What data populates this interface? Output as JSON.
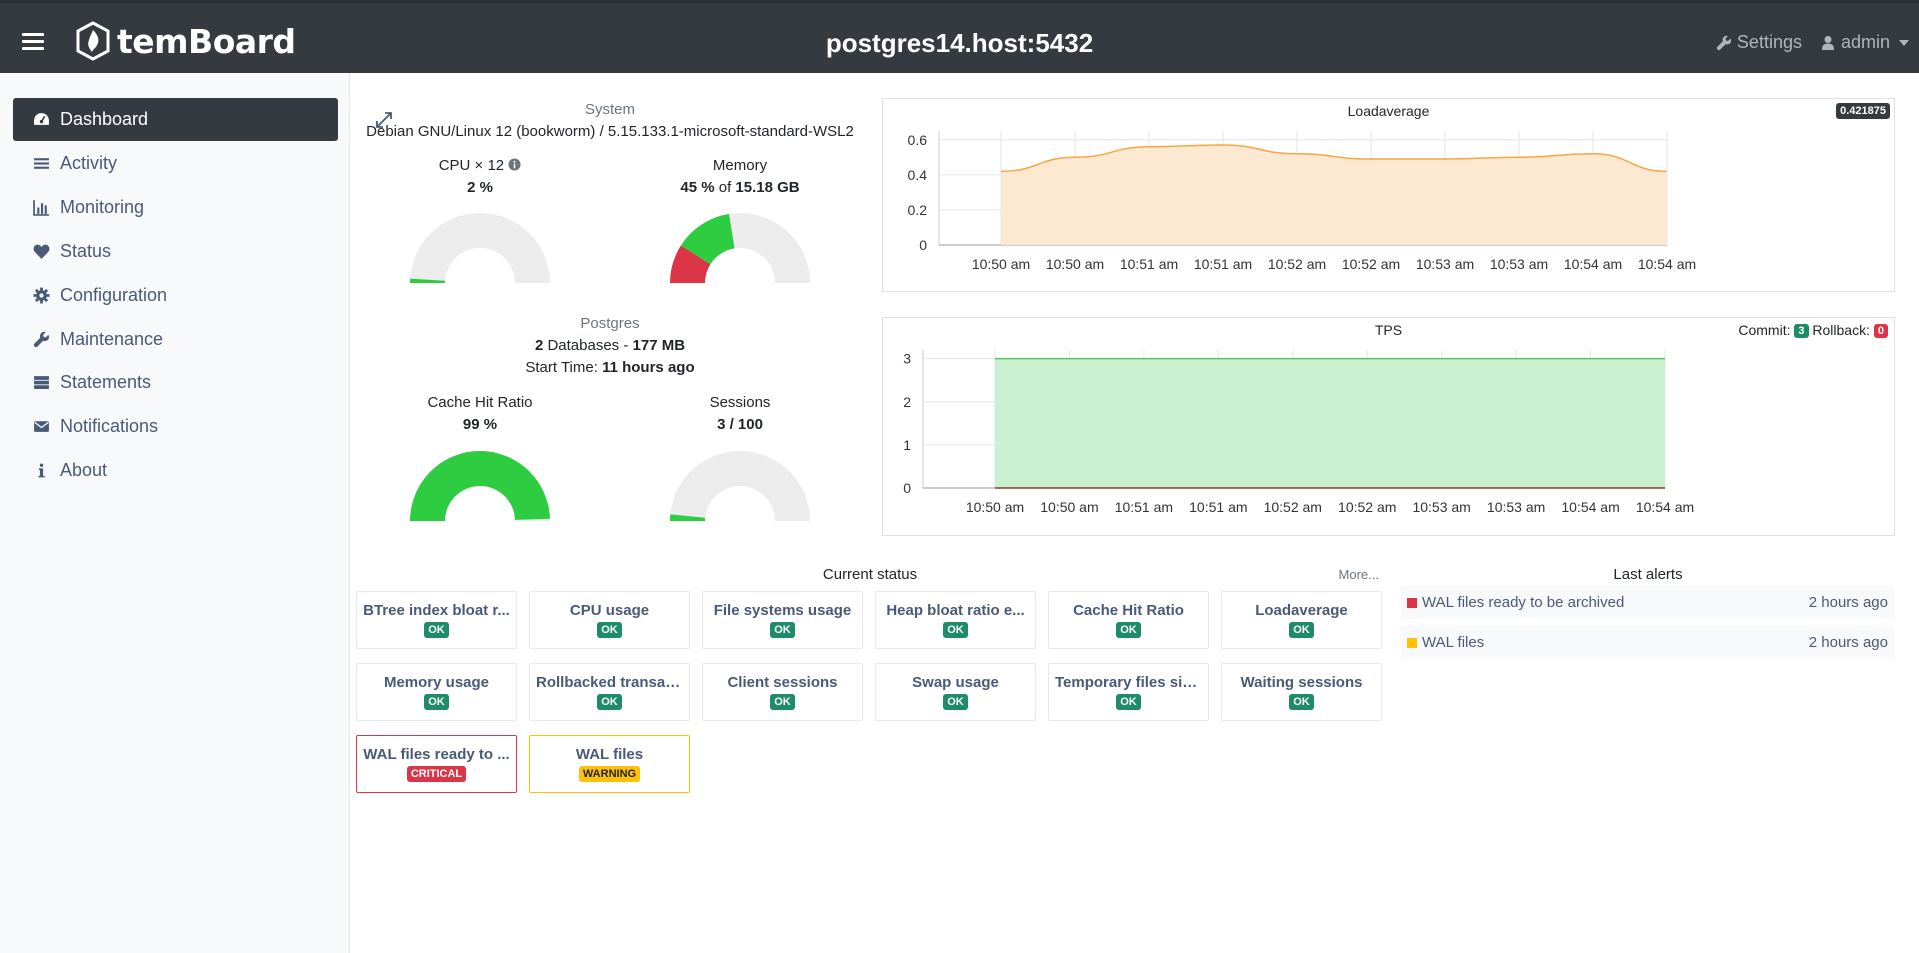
{
  "app": {
    "brand": "temBoard",
    "instance": "postgres14.host:5432"
  },
  "topnav": {
    "settings": "Settings",
    "user": "admin"
  },
  "sidebar": {
    "items": [
      {
        "label": "Dashboard",
        "icon": "dashboard-icon",
        "active": true
      },
      {
        "label": "Activity",
        "icon": "bars-icon"
      },
      {
        "label": "Monitoring",
        "icon": "bar-chart-icon"
      },
      {
        "label": "Status",
        "icon": "heart-icon"
      },
      {
        "label": "Configuration",
        "icon": "gear-icon"
      },
      {
        "label": "Maintenance",
        "icon": "wrench-icon"
      },
      {
        "label": "Statements",
        "icon": "server-icon"
      },
      {
        "label": "Notifications",
        "icon": "envelope-icon"
      },
      {
        "label": "About",
        "icon": "info-icon"
      }
    ]
  },
  "system": {
    "heading": "System",
    "os": "Debian GNU/Linux 12 (bookworm) / 5.15.133.1-microsoft-standard-WSL2",
    "cpu_label": "CPU × 12",
    "cpu_value": "2 %",
    "cpu_fraction": 0.02,
    "memory_label": "Memory",
    "memory_pct": "45 %",
    "memory_of": "of",
    "memory_total": "15.18 GB",
    "memory_fraction_used": 0.45
  },
  "postgres": {
    "heading": "Postgres",
    "db_count": "2",
    "db_text": "Databases -",
    "db_size": "177 MB",
    "start_label": "Start Time:",
    "start_value": "11 hours ago",
    "cache_label": "Cache Hit Ratio",
    "cache_value": "99 %",
    "cache_fraction": 0.99,
    "sessions_label": "Sessions",
    "sessions_value": "3 / 100",
    "sessions_fraction": 0.03
  },
  "loadavg": {
    "title": "Loadaverage",
    "current": "0.421875"
  },
  "tps": {
    "title": "TPS",
    "commit_label": "Commit:",
    "commit_value": "3",
    "rollback_label": "Rollback:",
    "rollback_value": "0"
  },
  "status": {
    "heading": "Current status",
    "more": "More...",
    "items": [
      {
        "name": "BTree index bloat r...",
        "state": "OK"
      },
      {
        "name": "CPU usage",
        "state": "OK"
      },
      {
        "name": "File systems usage",
        "state": "OK"
      },
      {
        "name": "Heap bloat ratio e...",
        "state": "OK"
      },
      {
        "name": "Cache Hit Ratio",
        "state": "OK"
      },
      {
        "name": "Loadaverage",
        "state": "OK"
      },
      {
        "name": "Memory usage",
        "state": "OK"
      },
      {
        "name": "Rollbacked transac...",
        "state": "OK"
      },
      {
        "name": "Client sessions",
        "state": "OK"
      },
      {
        "name": "Swap usage",
        "state": "OK"
      },
      {
        "name": "Temporary files siz...",
        "state": "OK"
      },
      {
        "name": "Waiting sessions",
        "state": "OK"
      },
      {
        "name": "WAL files ready to ...",
        "state": "CRITICAL"
      },
      {
        "name": "WAL files",
        "state": "WARNING"
      }
    ]
  },
  "alerts": {
    "heading": "Last alerts",
    "items": [
      {
        "text": "WAL files ready to be archived",
        "when": "2 hours ago",
        "color": "#dc3545"
      },
      {
        "text": "WAL files",
        "when": "2 hours ago",
        "color": "#ffc107"
      }
    ]
  },
  "colors": {
    "ok": "#1e8c67",
    "critical": "#dc3545",
    "warning": "#ffc107",
    "gauge_green": "#2ecc40",
    "load_line": "#f5a742",
    "load_fill": "#fde8d2",
    "tps_fill": "#c9f0cf",
    "tps_line": "#5ac464"
  },
  "chart_data": [
    {
      "type": "area",
      "title": "Loadaverage",
      "x": [
        "10:50 am",
        "10:50 am",
        "10:51 am",
        "10:51 am",
        "10:52 am",
        "10:52 am",
        "10:53 am",
        "10:53 am",
        "10:54 am",
        "10:54 am"
      ],
      "series": [
        {
          "values": [
            0.42,
            0.5,
            0.56,
            0.57,
            0.52,
            0.49,
            0.49,
            0.5,
            0.52,
            0.42
          ]
        }
      ],
      "yticks": [
        "0",
        "0.2",
        "0.4",
        "0.6"
      ],
      "ylim": [
        0,
        0.65
      ],
      "grid": true
    },
    {
      "type": "area",
      "title": "TPS",
      "x": [
        "10:50 am",
        "10:50 am",
        "10:51 am",
        "10:51 am",
        "10:52 am",
        "10:52 am",
        "10:53 am",
        "10:53 am",
        "10:54 am",
        "10:54 am"
      ],
      "series": [
        {
          "name": "Commit",
          "values": [
            3,
            3,
            3,
            3,
            3,
            3,
            3,
            3,
            3,
            3
          ]
        },
        {
          "name": "Rollback",
          "values": [
            0,
            0,
            0,
            0,
            0,
            0,
            0,
            0,
            0,
            0
          ]
        }
      ],
      "yticks": [
        "0",
        "1",
        "2",
        "3"
      ],
      "ylim": [
        0,
        3.2
      ],
      "grid": true
    }
  ]
}
